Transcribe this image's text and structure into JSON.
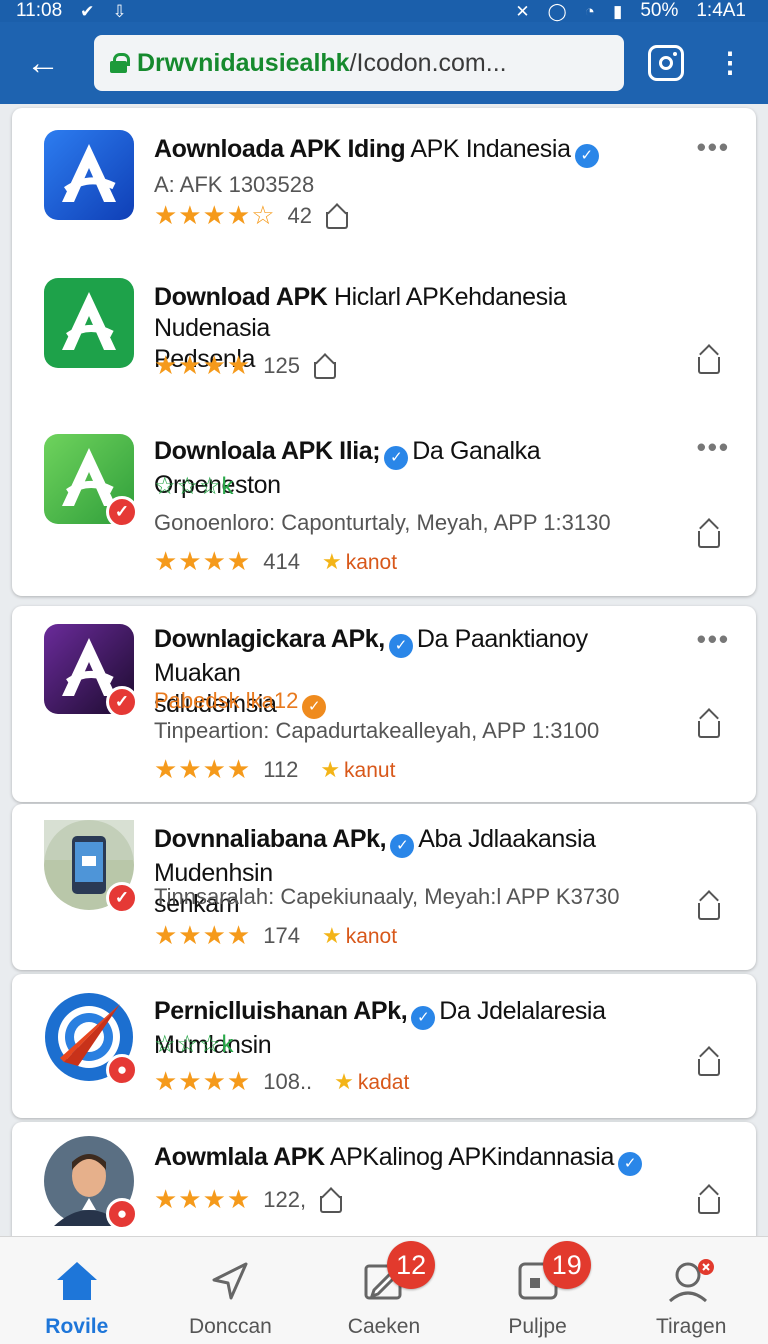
{
  "status": {
    "time": "11:08",
    "battery": "50%",
    "clock_right": "1:4A1"
  },
  "browser": {
    "url_host": "Drwvnidausiealhk",
    "url_rest": "/Icodon.com..."
  },
  "items": [
    {
      "title_bold": "Aownloada APK Iding",
      "title_rest": "APK Indanesia",
      "title_rest2": "",
      "subtitle": "A: AFK 1303528",
      "stars": "★★★★☆",
      "count": "42",
      "status_text": "",
      "green_stars": ""
    },
    {
      "title_bold": "Download APK",
      "title_rest": "Hiclarl APKehdanesia Nudenasia",
      "title_rest2": "Pedsenla",
      "subtitle": "",
      "stars": "★★★★",
      "count": "125",
      "status_text": "",
      "green_stars": ""
    },
    {
      "title_bold": "Downloala APK Ilia;",
      "title_rest": "Da Ganalka Orpeneston",
      "title_rest2": "",
      "green_stars": "☆☆☆k",
      "subtitle": "Gonoenloro: Caponturtaly, Meyah, APP 1:3130",
      "stars": "★★★★",
      "count": "414",
      "status_text": "kanot"
    },
    {
      "title_bold": "Downlagickara APk,",
      "title_rest": "Da Paanktianoy Muakan",
      "title_rest2": "sdludemsia",
      "orange_sub": "Pabedsk lka12",
      "subtitle": "Tinpeartion: Capadurtakealleyah, APP 1:3100",
      "stars": "★★★★",
      "count": "112",
      "status_text": "kanut",
      "green_stars": ""
    },
    {
      "title_bold": "Dovnnaliabana APk,",
      "title_rest": "Aba Jdlaakansia Mudenhsin",
      "title_rest2": "senkam",
      "subtitle": "Tinnsaralah: Capekiunaaly, Meyah:l APP K3730",
      "stars": "★★★★",
      "count": "174",
      "status_text": "kanot",
      "green_stars": ""
    },
    {
      "title_bold": "Perniclluishanan APk,",
      "title_rest": "Da Jdelalaresia Mumlansin",
      "title_rest2": "",
      "green_stars": "☆☆☆k",
      "subtitle": "",
      "stars": "★★★★",
      "count": "108..",
      "status_text": "kadat"
    },
    {
      "title_bold": "Aowmlala APK",
      "title_rest": "APKalinog APKindannasia",
      "title_rest2": "",
      "subtitle": "",
      "stars": "★★★★",
      "count": "122,",
      "status_text": "",
      "green_stars": ""
    }
  ],
  "nav": [
    {
      "label": "Rovile",
      "badge": ""
    },
    {
      "label": "Donccan",
      "badge": ""
    },
    {
      "label": "Caeken",
      "badge": "12"
    },
    {
      "label": "Puljpe",
      "badge": "19"
    },
    {
      "label": "Tiragen",
      "badge": ""
    }
  ],
  "colors": {
    "toolbar": "#1e63b0",
    "star": "#f59a1b",
    "accent": "#1e76d9",
    "badge": "#e23a2d"
  }
}
